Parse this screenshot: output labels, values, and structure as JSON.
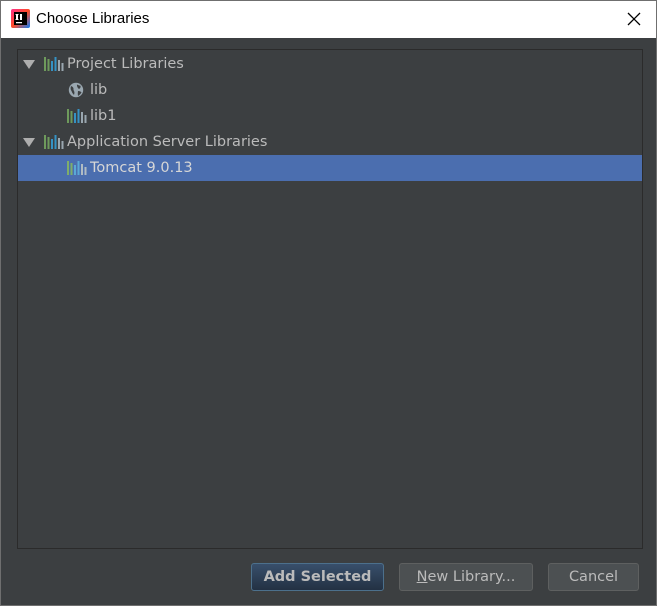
{
  "window": {
    "title": "Choose Libraries"
  },
  "tree": {
    "groups": [
      {
        "label": "Project Libraries",
        "expanded": true,
        "children": [
          {
            "label": "lib",
            "icon": "globe-icon"
          },
          {
            "label": "lib1",
            "icon": "library-icon"
          }
        ]
      },
      {
        "label": "Application Server Libraries",
        "expanded": true,
        "children": [
          {
            "label": "Tomcat 9.0.13",
            "icon": "library-icon",
            "selected": true
          }
        ]
      }
    ]
  },
  "buttons": {
    "add_selected": "Add Selected",
    "new_library_mnemonic": "N",
    "new_library_rest": "ew Library...",
    "cancel": "Cancel"
  },
  "colors": {
    "background": "#3c3f41",
    "selection": "#4b6eaf",
    "text": "#bbbbbb",
    "default_button": "#365880"
  }
}
